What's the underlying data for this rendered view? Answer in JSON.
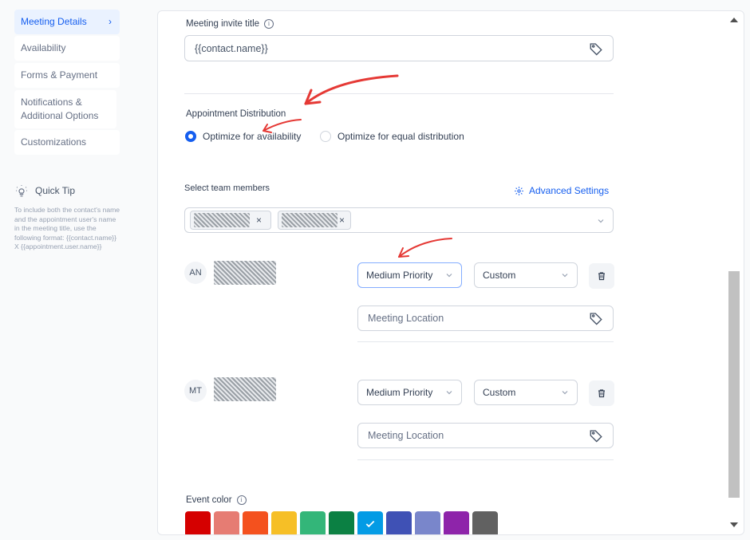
{
  "sidebar": {
    "items": [
      {
        "label": "Meeting Details",
        "active": true
      },
      {
        "label": "Availability"
      },
      {
        "label": "Forms & Payment"
      },
      {
        "label": "Notifications & Additional Options"
      },
      {
        "label": "Customizations"
      }
    ],
    "tip_title": "Quick Tip",
    "tip_body": "To include both the contact's name and the appointment user's name in the meeting title, use the following format: {{contact.name}} X {{appointment.user.name}}"
  },
  "form": {
    "invite_title_label": "Meeting invite title",
    "invite_title_value": "{{contact.name}}",
    "distribution_label": "Appointment Distribution",
    "distribution_options": [
      "Optimize for availability",
      "Optimize for equal distribution"
    ],
    "distribution_selected": 0,
    "team_label": "Select team members",
    "advanced_settings": "Advanced Settings",
    "members": [
      {
        "initials": "AN",
        "priority": "Medium Priority",
        "mode": "Custom",
        "location_placeholder": "Meeting Location"
      },
      {
        "initials": "MT",
        "priority": "Medium Priority",
        "mode": "Custom",
        "location_placeholder": "Meeting Location"
      }
    ],
    "event_color_label": "Event color",
    "event_colors": [
      "#d50000",
      "#e67c73",
      "#f4511e",
      "#f6bf26",
      "#33b679",
      "#0b8043",
      "#039be5",
      "#3f51b5",
      "#7986cb",
      "#8e24aa",
      "#616161"
    ],
    "selected_color_index": 6
  },
  "annotation_color": "#e53935"
}
